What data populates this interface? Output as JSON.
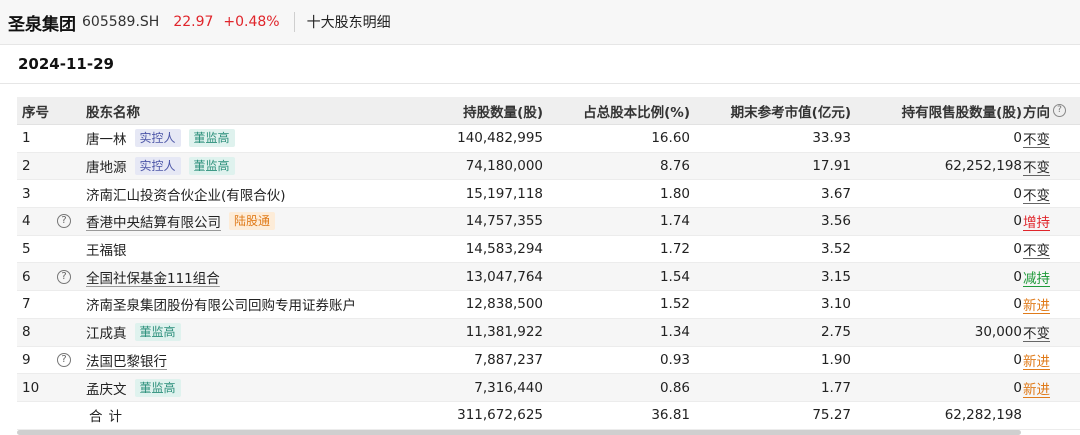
{
  "header": {
    "stock_name": "圣泉集团",
    "stock_code": "605589.SH",
    "price": "22.97",
    "change": "+0.48%",
    "section": "十大股东明细"
  },
  "date": "2024-11-29",
  "table": {
    "columns": {
      "idx": "序号",
      "name": "股东名称",
      "shares": "持股数量(股)",
      "ratio": "占总股本比例(%)",
      "market_value": "期末参考市值(亿元)",
      "restricted": "持有限售股数量(股)",
      "direction": "方向"
    },
    "rows": [
      {
        "idx": "1",
        "name": "唐一林",
        "tags": [
          "实控人",
          "董监高"
        ],
        "shares": "140,482,995",
        "ratio": "16.60",
        "market_value": "33.93",
        "restricted": "0",
        "direction": "不变"
      },
      {
        "idx": "2",
        "name": "唐地源",
        "tags": [
          "实控人",
          "董监高"
        ],
        "shares": "74,180,000",
        "ratio": "8.76",
        "market_value": "17.91",
        "restricted": "62,252,198",
        "direction": "不变"
      },
      {
        "idx": "3",
        "name": "济南汇山投资合伙企业(有限合伙)",
        "tags": [],
        "shares": "15,197,118",
        "ratio": "1.80",
        "market_value": "3.67",
        "restricted": "0",
        "direction": "不变"
      },
      {
        "idx": "4",
        "name": "香港中央結算有限公司",
        "tags": [
          "陆股通"
        ],
        "shares": "14,757,355",
        "ratio": "1.74",
        "market_value": "3.56",
        "restricted": "0",
        "direction": "增持"
      },
      {
        "idx": "5",
        "name": "王福银",
        "tags": [],
        "shares": "14,583,294",
        "ratio": "1.72",
        "market_value": "3.52",
        "restricted": "0",
        "direction": "不变"
      },
      {
        "idx": "6",
        "name": "全国社保基金111组合",
        "tags": [],
        "shares": "13,047,764",
        "ratio": "1.54",
        "market_value": "3.15",
        "restricted": "0",
        "direction": "减持"
      },
      {
        "idx": "7",
        "name": "济南圣泉集团股份有限公司回购专用证券账户",
        "tags": [],
        "shares": "12,838,500",
        "ratio": "1.52",
        "market_value": "3.10",
        "restricted": "0",
        "direction": "新进"
      },
      {
        "idx": "8",
        "name": "江成真",
        "tags": [
          "董监高"
        ],
        "shares": "11,381,922",
        "ratio": "1.34",
        "market_value": "2.75",
        "restricted": "30,000",
        "direction": "不变"
      },
      {
        "idx": "9",
        "name": "法国巴黎银行",
        "tags": [],
        "shares": "7,887,237",
        "ratio": "0.93",
        "market_value": "1.90",
        "restricted": "0",
        "direction": "新进"
      },
      {
        "idx": "10",
        "name": "孟庆文",
        "tags": [
          "董监高"
        ],
        "shares": "7,316,440",
        "ratio": "0.86",
        "market_value": "1.77",
        "restricted": "0",
        "direction": "新进"
      }
    ],
    "total": {
      "label": "合计",
      "shares": "311,672,625",
      "ratio": "36.81",
      "market_value": "75.27",
      "restricted": "62,282,198"
    }
  },
  "colors": {
    "up": "#e0252b",
    "down": "#1f9a3a",
    "new": "#e07b1a",
    "tag_controller": "#4d57a8",
    "tag_board": "#2a8f7a",
    "tag_connect": "#e07b1a"
  },
  "icons": {
    "help": "question-circle-icon"
  }
}
